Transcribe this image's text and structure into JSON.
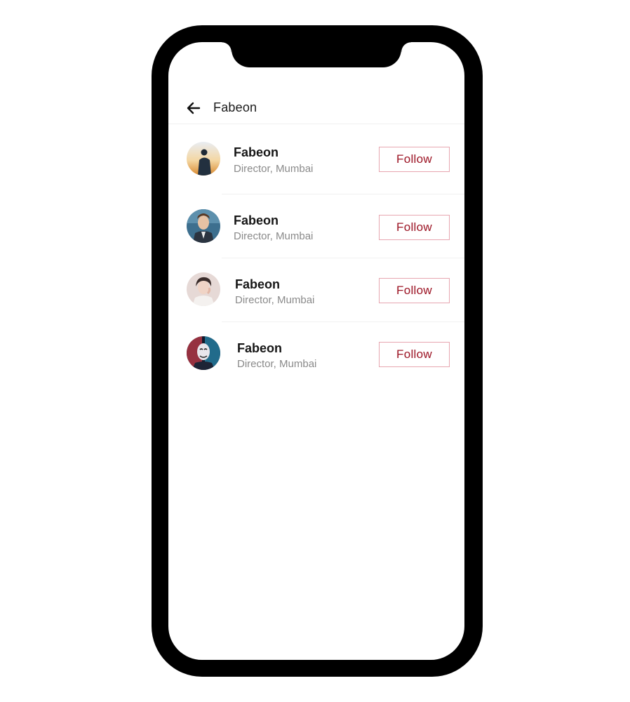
{
  "header": {
    "back_icon": "arrow-left-icon",
    "title": "Fabeon"
  },
  "people": [
    {
      "name": "Fabeon",
      "subtitle": "Director, Mumbai",
      "follow_label": "Follow",
      "avatar": "avatar-photo-silhouette-sunset"
    },
    {
      "name": "Fabeon",
      "subtitle": "Director, Mumbai",
      "follow_label": "Follow",
      "avatar": "avatar-photo-man-sea"
    },
    {
      "name": "Fabeon",
      "subtitle": "Director, Mumbai",
      "follow_label": "Follow",
      "avatar": "avatar-photo-young-man"
    },
    {
      "name": "Fabeon",
      "subtitle": "Director, Mumbai",
      "follow_label": "Follow",
      "avatar": "avatar-photo-mask-neon"
    }
  ],
  "colors": {
    "accent": "#9c1424",
    "button_border": "#e7a6b0",
    "subtitle": "#8a8a8a"
  }
}
